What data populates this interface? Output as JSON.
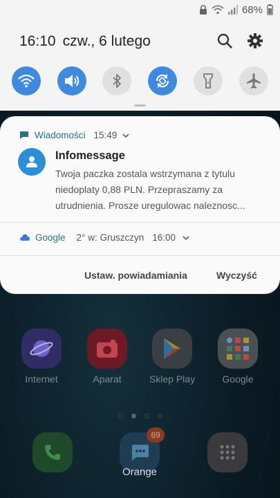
{
  "status_bar": {
    "battery": "68%"
  },
  "header": {
    "time": "16:10",
    "date": "czw., 6 lutego"
  },
  "quick_settings": [
    {
      "name": "wifi",
      "state": "on"
    },
    {
      "name": "sound",
      "state": "on"
    },
    {
      "name": "bluetooth",
      "state": "off"
    },
    {
      "name": "auto-rotate",
      "state": "on"
    },
    {
      "name": "flashlight",
      "state": "off"
    },
    {
      "name": "airplane-mode",
      "state": "off"
    }
  ],
  "notifications": [
    {
      "app": "Wiadomości",
      "time": "15:49",
      "title": "Infomessage",
      "body_lines": [
        "Twoja paczka zostala wstrzymana z tytulu",
        "niedoplaty 0,88 PLN. Przepraszamy za",
        "utrudnienia. Prosze uregulowac naleznosc..."
      ],
      "icon": "chat-bubble-icon",
      "accent": "#2a6f87"
    },
    {
      "app": "Google",
      "text": "2° w: Gruszczyn",
      "time": "16:00",
      "icon": "cloud-icon"
    }
  ],
  "actions": {
    "settings_label": "Ustaw. powiadamiania",
    "clear_label": "Wyczyść"
  },
  "home_apps": [
    {
      "label": "Internet"
    },
    {
      "label": "Aparat"
    },
    {
      "label": "Sklep Play"
    },
    {
      "label": "Google"
    }
  ],
  "dock": {
    "messages_label": "Orange",
    "messages_badge": "69"
  },
  "colors": {
    "accent": "#3d8ae0",
    "panel_bg": "#f4f4f4",
    "card_bg": "#fafafa"
  }
}
